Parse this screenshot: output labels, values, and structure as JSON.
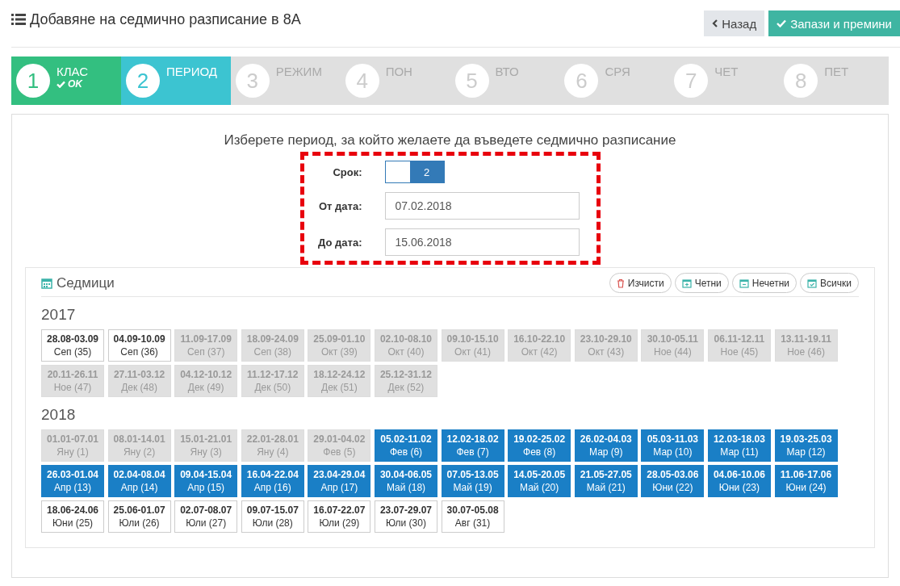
{
  "header": {
    "title": "Добавяне на седмично разписание в 8А",
    "back_button": "Назад",
    "save_button": "Запази и премини"
  },
  "steps": [
    {
      "number": "1",
      "label": "КЛАС",
      "completed": true,
      "selected": false,
      "status": "OK"
    },
    {
      "number": "2",
      "label": "ПЕРИОД",
      "completed": false,
      "selected": true
    },
    {
      "number": "3",
      "label": "РЕЖИМ",
      "completed": false,
      "selected": false
    },
    {
      "number": "4",
      "label": "ПОН",
      "completed": false,
      "selected": false
    },
    {
      "number": "5",
      "label": "ВТО",
      "completed": false,
      "selected": false
    },
    {
      "number": "6",
      "label": "СРЯ",
      "completed": false,
      "selected": false
    },
    {
      "number": "7",
      "label": "ЧЕТ",
      "completed": false,
      "selected": false
    },
    {
      "number": "8",
      "label": "ПЕТ",
      "completed": false,
      "selected": false
    }
  ],
  "period": {
    "instruction": "Изберете период, за който желаете да въведете седмично разписание",
    "highlighted": true,
    "term": {
      "label": "Срок:",
      "value": "2"
    },
    "from": {
      "label": "От дата:",
      "value": "07.02.2018"
    },
    "to": {
      "label": "До дата:",
      "value": "15.06.2018"
    }
  },
  "weeks": {
    "title": "Седмици",
    "actions": [
      {
        "kind": "clear",
        "label": "Изчисти"
      },
      {
        "kind": "even",
        "label": "Четни"
      },
      {
        "kind": "odd",
        "label": "Нечетни"
      },
      {
        "kind": "all",
        "label": "Всички"
      }
    ],
    "years": [
      {
        "year": "2017",
        "weeks": [
          {
            "dates": "28.08-03.09",
            "month": "Сеп (35)",
            "disabled": false,
            "selected": false
          },
          {
            "dates": "04.09-10.09",
            "month": "Сеп (36)",
            "disabled": false,
            "selected": false
          },
          {
            "dates": "11.09-17.09",
            "month": "Сеп (37)",
            "disabled": true,
            "selected": false
          },
          {
            "dates": "18.09-24.09",
            "month": "Сеп (38)",
            "disabled": true,
            "selected": false
          },
          {
            "dates": "25.09-01.10",
            "month": "Окт (39)",
            "disabled": true,
            "selected": false
          },
          {
            "dates": "02.10-08.10",
            "month": "Окт (40)",
            "disabled": true,
            "selected": false
          },
          {
            "dates": "09.10-15.10",
            "month": "Окт (41)",
            "disabled": true,
            "selected": false
          },
          {
            "dates": "16.10-22.10",
            "month": "Окт (42)",
            "disabled": true,
            "selected": false
          },
          {
            "dates": "23.10-29.10",
            "month": "Окт (43)",
            "disabled": true,
            "selected": false
          },
          {
            "dates": "30.10-05.11",
            "month": "Ное (44)",
            "disabled": true,
            "selected": false
          },
          {
            "dates": "06.11-12.11",
            "month": "Ное (45)",
            "disabled": true,
            "selected": false
          },
          {
            "dates": "13.11-19.11",
            "month": "Ное (46)",
            "disabled": true,
            "selected": false
          },
          {
            "dates": "20.11-26.11",
            "month": "Ное (47)",
            "disabled": true,
            "selected": false
          },
          {
            "dates": "27.11-03.12",
            "month": "Дек (48)",
            "disabled": true,
            "selected": false
          },
          {
            "dates": "04.12-10.12",
            "month": "Дек (49)",
            "disabled": true,
            "selected": false
          },
          {
            "dates": "11.12-17.12",
            "month": "Дек (50)",
            "disabled": true,
            "selected": false
          },
          {
            "dates": "18.12-24.12",
            "month": "Дек (51)",
            "disabled": true,
            "selected": false
          },
          {
            "dates": "25.12-31.12",
            "month": "Дек (52)",
            "disabled": true,
            "selected": false
          }
        ]
      },
      {
        "year": "2018",
        "weeks": [
          {
            "dates": "01.01-07.01",
            "month": "Яну (1)",
            "disabled": true,
            "selected": false
          },
          {
            "dates": "08.01-14.01",
            "month": "Яну (2)",
            "disabled": true,
            "selected": false
          },
          {
            "dates": "15.01-21.01",
            "month": "Яну (3)",
            "disabled": true,
            "selected": false
          },
          {
            "dates": "22.01-28.01",
            "month": "Яну (4)",
            "disabled": true,
            "selected": false
          },
          {
            "dates": "29.01-04.02",
            "month": "Фев (5)",
            "disabled": true,
            "selected": false
          },
          {
            "dates": "05.02-11.02",
            "month": "Фев (6)",
            "disabled": false,
            "selected": true
          },
          {
            "dates": "12.02-18.02",
            "month": "Фев (7)",
            "disabled": false,
            "selected": true
          },
          {
            "dates": "19.02-25.02",
            "month": "Фев (8)",
            "disabled": false,
            "selected": true
          },
          {
            "dates": "26.02-04.03",
            "month": "Мар (9)",
            "disabled": false,
            "selected": true
          },
          {
            "dates": "05.03-11.03",
            "month": "Мар (10)",
            "disabled": false,
            "selected": true
          },
          {
            "dates": "12.03-18.03",
            "month": "Мар (11)",
            "disabled": false,
            "selected": true
          },
          {
            "dates": "19.03-25.03",
            "month": "Мар (12)",
            "disabled": false,
            "selected": true
          },
          {
            "dates": "26.03-01.04",
            "month": "Апр (13)",
            "disabled": false,
            "selected": true
          },
          {
            "dates": "02.04-08.04",
            "month": "Апр (14)",
            "disabled": false,
            "selected": true
          },
          {
            "dates": "09.04-15.04",
            "month": "Апр (15)",
            "disabled": false,
            "selected": true
          },
          {
            "dates": "16.04-22.04",
            "month": "Апр (16)",
            "disabled": false,
            "selected": true
          },
          {
            "dates": "23.04-29.04",
            "month": "Апр (17)",
            "disabled": false,
            "selected": true
          },
          {
            "dates": "30.04-06.05",
            "month": "Май (18)",
            "disabled": false,
            "selected": true
          },
          {
            "dates": "07.05-13.05",
            "month": "Май (19)",
            "disabled": false,
            "selected": true
          },
          {
            "dates": "14.05-20.05",
            "month": "Май (20)",
            "disabled": false,
            "selected": true
          },
          {
            "dates": "21.05-27.05",
            "month": "Май (21)",
            "disabled": false,
            "selected": true
          },
          {
            "dates": "28.05-03.06",
            "month": "Юни (22)",
            "disabled": false,
            "selected": true
          },
          {
            "dates": "04.06-10.06",
            "month": "Юни (23)",
            "disabled": false,
            "selected": true
          },
          {
            "dates": "11.06-17.06",
            "month": "Юни (24)",
            "disabled": false,
            "selected": true
          },
          {
            "dates": "18.06-24.06",
            "month": "Юни (25)",
            "disabled": false,
            "selected": false
          },
          {
            "dates": "25.06-01.07",
            "month": "Юли (26)",
            "disabled": false,
            "selected": false
          },
          {
            "dates": "02.07-08.07",
            "month": "Юли (27)",
            "disabled": false,
            "selected": false
          },
          {
            "dates": "09.07-15.07",
            "month": "Юли (28)",
            "disabled": false,
            "selected": false
          },
          {
            "dates": "16.07-22.07",
            "month": "Юли (29)",
            "disabled": false,
            "selected": false
          },
          {
            "dates": "23.07-29.07",
            "month": "Юли (30)",
            "disabled": false,
            "selected": false
          },
          {
            "dates": "30.07-05.08",
            "month": "Авг (31)",
            "disabled": false,
            "selected": false
          }
        ]
      }
    ]
  }
}
